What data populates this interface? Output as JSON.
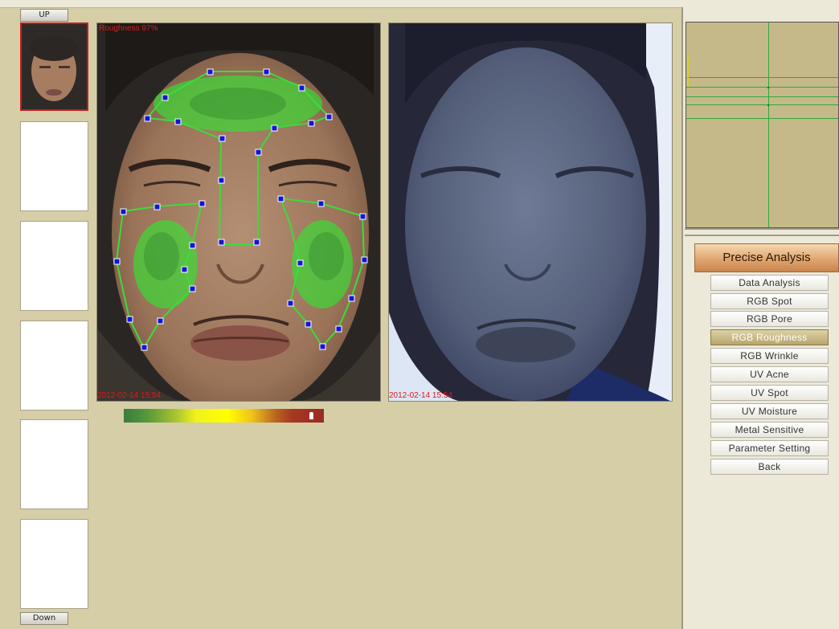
{
  "nav": {
    "up_label": "UP",
    "down_label": "Down"
  },
  "photos": {
    "left_overlay": "Roughness 97%",
    "left_timestamp": "2012-02-14 15:54",
    "right_timestamp": "2012-02-14 15:54"
  },
  "scale": {
    "level_fraction": 0.94
  },
  "colors": {
    "accent_active": "#b7a56c",
    "overlay_text": "#e01a1a",
    "analysis_outline": "#3bdc3b"
  },
  "menu": {
    "header": "Precise Analysis",
    "items": [
      {
        "label": "Data Analysis",
        "active": false
      },
      {
        "label": "RGB Spot",
        "active": false
      },
      {
        "label": "RGB Pore",
        "active": false
      },
      {
        "label": "RGB Roughness",
        "active": true
      },
      {
        "label": "RGB Wrinkle",
        "active": false
      },
      {
        "label": "UV Acne",
        "active": false
      },
      {
        "label": "UV Spot",
        "active": false
      },
      {
        "label": "UV Moisture",
        "active": false
      },
      {
        "label": "Metal Sensitive",
        "active": false
      },
      {
        "label": "Parameter Setting",
        "active": false
      },
      {
        "label": "Back",
        "active": false
      }
    ]
  }
}
